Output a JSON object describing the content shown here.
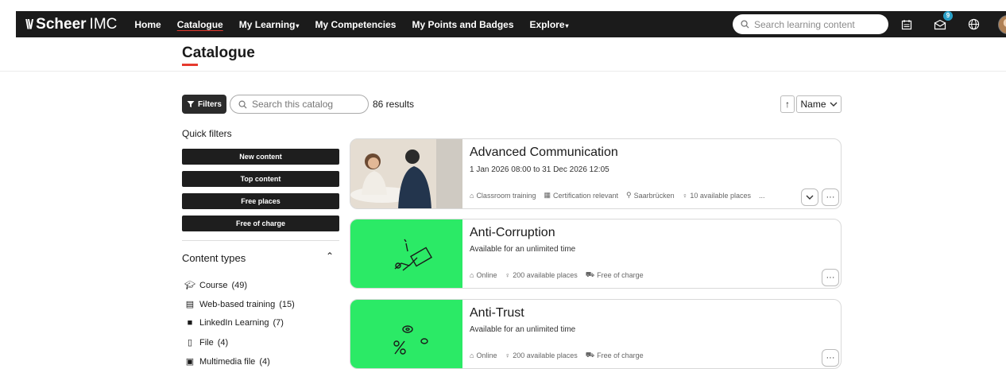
{
  "brand": {
    "mark": "\\\\/",
    "name": "Scheer",
    "suffix": "IMC"
  },
  "nav": [
    {
      "label": "Home",
      "active": false,
      "dropdown": false
    },
    {
      "label": "Catalogue",
      "active": true,
      "dropdown": false
    },
    {
      "label": "My Learning",
      "active": false,
      "dropdown": true
    },
    {
      "label": "My Competencies",
      "active": false,
      "dropdown": false
    },
    {
      "label": "My Points and Badges",
      "active": false,
      "dropdown": false
    },
    {
      "label": "Explore",
      "active": false,
      "dropdown": true
    }
  ],
  "top_search": {
    "placeholder": "Search learning content"
  },
  "notifications": {
    "count": "9"
  },
  "page": {
    "title": "Catalogue"
  },
  "toolbar": {
    "filters_label": "Filters",
    "search_placeholder": "Search this catalog",
    "results": "86 results",
    "sort_label": "Name"
  },
  "quick_filters": {
    "title": "Quick filters",
    "items": [
      "New content",
      "Top content",
      "Free places",
      "Free of charge"
    ]
  },
  "content_types": {
    "title": "Content types",
    "items": [
      {
        "icon": "graduation-cap-icon",
        "label": "Course",
        "count": "(49)"
      },
      {
        "icon": "web-training-icon",
        "label": "Web-based training",
        "count": "(15)"
      },
      {
        "icon": "linkedin-icon",
        "label": "LinkedIn Learning",
        "count": "(7)"
      },
      {
        "icon": "file-icon",
        "label": "File",
        "count": "(4)"
      },
      {
        "icon": "multimedia-file-icon",
        "label": "Multimedia file",
        "count": "(4)"
      }
    ]
  },
  "cards": [
    {
      "title": "Advanced Communication",
      "subtitle": "1 Jan 2026 08:00 to 31 Dec 2026 12:05",
      "meta": [
        "Classroom training",
        "Certification relevant",
        "Saarbrücken",
        "10 available places",
        "..."
      ],
      "thumb": "photo",
      "thumb_color": "#cfc6bb"
    },
    {
      "title": "Anti-Corruption",
      "subtitle": "Available for an unlimited time",
      "meta": [
        "Online",
        "200 available places",
        "Free of charge"
      ],
      "thumb": "handshake-money-icon",
      "thumb_color": "#2bea66"
    },
    {
      "title": "Anti-Trust",
      "subtitle": "Available for an unlimited time",
      "meta": [
        "Online",
        "200 available places",
        "Free of charge"
      ],
      "thumb": "percent-coins-icon",
      "thumb_color": "#2bea66"
    }
  ]
}
